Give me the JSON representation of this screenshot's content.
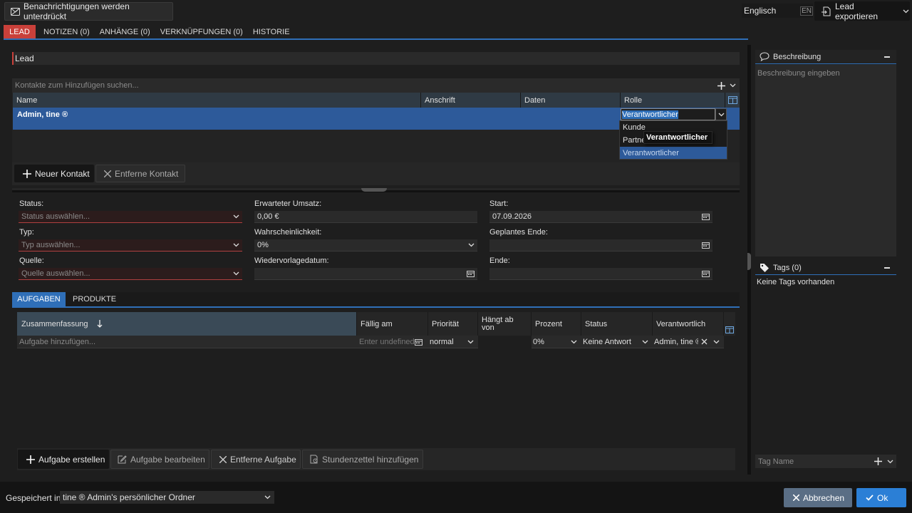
{
  "topbar": {
    "notifications_label": "Benachrichtigungen werden unterdrückt",
    "language_value": "Englisch",
    "language_code": "EN",
    "export_label": "Lead exportieren"
  },
  "tabs": [
    {
      "label": "Lead",
      "active": true
    },
    {
      "label": "Notizen (0)"
    },
    {
      "label": "Anhänge (0)"
    },
    {
      "label": "Verknüpfungen (0)"
    },
    {
      "label": "Historie"
    }
  ],
  "lead_title": "Lead",
  "contacts": {
    "search_placeholder": "Kontakte zum Hinzufügen suchen...",
    "columns": [
      "Name",
      "Anschrift",
      "Daten",
      "Rolle"
    ],
    "rows": [
      {
        "name": "Admin, tine ®",
        "address": "",
        "data": "",
        "role": "Verantwortlicher"
      }
    ],
    "role_options": [
      "Kunde",
      "Partner",
      "Verantwortlicher"
    ],
    "tooltip": "Verantwortlicher",
    "new_contact_label": "Neuer Kontakt",
    "remove_contact_label": "Entferne Kontakt"
  },
  "form": {
    "status_label": "Status:",
    "status_placeholder": "Status auswählen...",
    "type_label": "Typ:",
    "type_placeholder": "Typ auswählen...",
    "source_label": "Quelle:",
    "source_placeholder": "Quelle auswählen...",
    "turnover_label": "Erwarteter Umsatz:",
    "turnover_value": "0,00 €",
    "probability_label": "Wahrscheinlichkeit:",
    "probability_value": "0%",
    "resubmission_label": "Wiedervorlagedatum:",
    "start_label": "Start:",
    "start_value": "07.09.2026",
    "planned_end_label": "Geplantes Ende:",
    "end_label": "Ende:"
  },
  "subtabs": [
    {
      "label": "Aufgaben",
      "active": true
    },
    {
      "label": "Produkte"
    }
  ],
  "tasks": {
    "columns": [
      "Zusammenfassung",
      "Fällig am",
      "Priorität",
      "Hängt ab von",
      "Prozent",
      "Status",
      "Verantwortlich"
    ],
    "add_placeholder": "Aufgabe hinzufügen...",
    "due_placeholder": "Enter undefined",
    "priority_value": "normal",
    "percent_value": "0%",
    "status_value": "Keine Antwort",
    "responsible_value": "Admin, tine ®",
    "create_label": "Aufgabe erstellen",
    "edit_label": "Aufgabe bearbeiten",
    "remove_label": "Entferne Aufgabe",
    "timesheet_label": "Stundenzettel hinzufügen"
  },
  "sidebar": {
    "description_title": "Beschreibung",
    "description_placeholder": "Beschreibung eingeben",
    "tags_title": "Tags (0)",
    "no_tags": "Keine Tags vorhanden",
    "tag_placeholder": "Tag Name"
  },
  "footer": {
    "saved_in_label": "Gespeichert in",
    "folder_value": "tine ® Admin's persönlicher Ordner",
    "cancel_label": "Abbrechen",
    "ok_label": "Ok"
  },
  "colors": {
    "accent": "#2f6fb8",
    "active_tab": "#c9403a",
    "selected_row": "#2d5a9a",
    "ok_button": "#2b7fd6",
    "cancel_button": "#5a6e85"
  }
}
